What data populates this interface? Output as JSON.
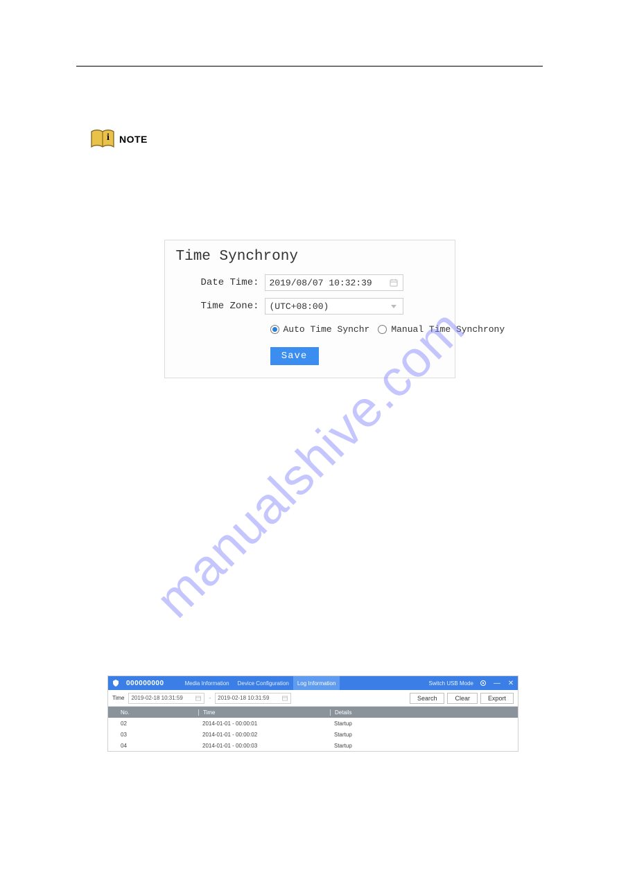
{
  "note": {
    "label": "NOTE",
    "icon_letter": "i"
  },
  "sync": {
    "title": "Time Synchrony",
    "date_label": "Date Time:",
    "date_value": "2019/08/07 10:32:39",
    "zone_label": "Time Zone:",
    "zone_value": "(UTC+08:00)",
    "radio_auto": "Auto Time Synchr",
    "radio_manual": "Manual Time Synchrony",
    "radio_selected": "auto",
    "save": "Save"
  },
  "log": {
    "serial": "000000000",
    "tabs": {
      "media": "Media Information",
      "device": "Device Configuration",
      "log": "Log Information"
    },
    "active_tab": "log",
    "switch_label": "Switch USB Mode",
    "filter": {
      "time_label": "Time",
      "start": "2019-02-18 10:31:59",
      "end": "2019-02-18 10:31:59"
    },
    "buttons": {
      "search": "Search",
      "clear": "Clear",
      "export": "Export"
    },
    "columns": {
      "no": "No.",
      "time": "Time",
      "details": "Details"
    },
    "rows": [
      {
        "no": "02",
        "time": "2014-01-01 - 00:00:01",
        "details": "Startup"
      },
      {
        "no": "03",
        "time": "2014-01-01 - 00:00:02",
        "details": "Startup"
      },
      {
        "no": "04",
        "time": "2014-01-01 - 00:00:03",
        "details": "Startup"
      }
    ]
  },
  "watermark": "manualshive.com"
}
